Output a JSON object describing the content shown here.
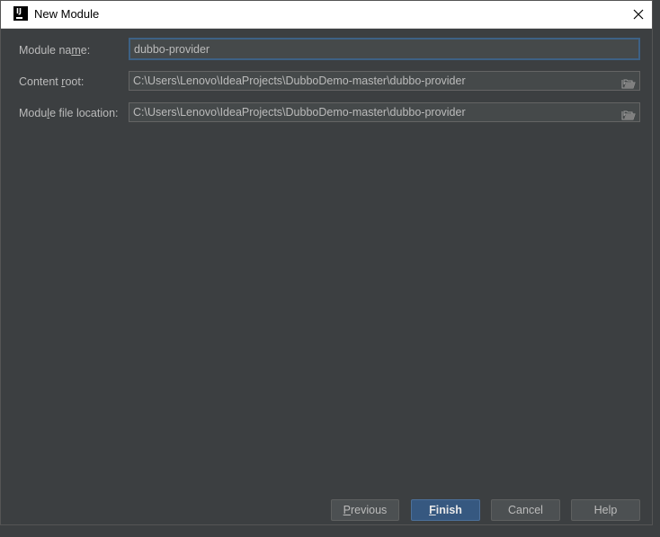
{
  "window": {
    "title": "New Module"
  },
  "form": {
    "module_name": {
      "label_before": "Module na",
      "label_mnemonic": "m",
      "label_after": "e:",
      "value": "dubbo-provider"
    },
    "content_root": {
      "label_before": "Content ",
      "label_mnemonic": "r",
      "label_after": "oot:",
      "value": "C:\\Users\\Lenovo\\IdeaProjects\\DubboDemo-master\\dubbo-provider"
    },
    "module_file_location": {
      "label_before": "Modu",
      "label_mnemonic": "l",
      "label_after": "e file location:",
      "value": "C:\\Users\\Lenovo\\IdeaProjects\\DubboDemo-master\\dubbo-provider"
    }
  },
  "buttons": {
    "previous": {
      "mnemonic": "P",
      "rest": "revious"
    },
    "finish": {
      "mnemonic": "F",
      "rest": "inish"
    },
    "cancel": {
      "label": "Cancel"
    },
    "help": {
      "label": "Help"
    }
  },
  "colors": {
    "dialog_bg": "#3c3f41",
    "field_bg": "#45494a",
    "focus_border": "#3d6185",
    "primary_button": "#365880",
    "text": "#bbbbbb"
  },
  "icons": {
    "app": "intellij-icon",
    "close": "close-icon",
    "browse": "folder-open-icon"
  }
}
